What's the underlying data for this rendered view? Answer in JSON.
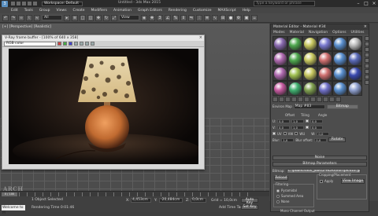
{
  "app": {
    "title": "Untitled - 3ds Max 2015",
    "workspace": "Workspace: Default",
    "search_placeholder": "Type a keyword or phrase"
  },
  "menus": [
    "Edit",
    "Tools",
    "Group",
    "Views",
    "Create",
    "Modifiers",
    "Animation",
    "Graph Editors",
    "Rendering",
    "Customize",
    "MAXScript",
    "Help"
  ],
  "toolbar": {
    "filter": "All",
    "view": "View"
  },
  "viewport": {
    "label": "[+] [Perspective] [Realistic]"
  },
  "vfb": {
    "title": "V-Ray frame buffer - [100% of 640 x 358]",
    "channel": "RGB color"
  },
  "material_editor": {
    "title": "Material Editor - Material #34",
    "menus": [
      "Modes",
      "Material",
      "Navigation",
      "Options",
      "Utilities"
    ],
    "map_label": "Environ Map",
    "map_name": "Map #83",
    "map_type": "Bitmap",
    "sphere_colors": [
      "#8a6ab0",
      "#4fa84f",
      "#c8c860",
      "#7a7ad0",
      "#5a8fcf",
      "#bbbbbb",
      "#b06ab0",
      "#4fa84f",
      "#c8c860",
      "#d07070",
      "#5a8fcf",
      "#5a6ab8",
      "#b06ab0",
      "#a0c050",
      "#c8c860",
      "#d07070",
      "#5a8fcf",
      "#3a4ab0",
      "#c65aa0",
      "#40b070",
      "#80a050",
      "#7070c8",
      "#5a8fcf",
      "#8fa0cf"
    ],
    "coords": {
      "u_offset": "0,0",
      "v_offset": "0,0",
      "u_tiling": "1,0",
      "v_tiling": "1,0",
      "u_angle": "0,0",
      "v_angle": "0,0",
      "w_angle": "0,0",
      "blur": "1,0",
      "blur_offset": "0,0",
      "uv_label": "UV",
      "vw_label": "VW",
      "wu_label": "WU",
      "rotate": "Rotate",
      "blur_label": "Blur:",
      "blur_offset_label": "Blur offset:",
      "offset_label": "Offset",
      "tiling_label": "Tiling",
      "angle_label": "Angle"
    },
    "noise": "Noise",
    "bitmap_params": "Bitmap Parameters",
    "bitmap_label": "Bitmap:",
    "bitmap_path": "C:\\publichaus_Jobs\\2-HDRI\\hdri\\pic022.jpg",
    "reload": "Reload",
    "cropping": "Cropping/Placement",
    "apply": "Apply",
    "view_image": "View Image",
    "filtering": "Filtering",
    "pyramidal": "Pyramidal",
    "summed_area": "Summed Area",
    "none": "None",
    "mono_channel": "Mono Channel Output"
  },
  "timeline": {
    "position": "0 / 100"
  },
  "status": {
    "welcome": "Welcome to M",
    "selected": "1 Object Selected",
    "render_time": "Rendering Time 0:01:46",
    "x_label": "X:",
    "x": "4,453cm",
    "y_label": "Y:",
    "y": "-20,484cm",
    "z_label": "Z:",
    "z": "0,0cm",
    "grid": "Grid = 10,0cm",
    "auto_key": "Auto Key",
    "set_key": "Set Key",
    "selected_dd": "Selected",
    "key_filters": "Key Filters...",
    "add_time_tag": "Add Time Tag"
  }
}
